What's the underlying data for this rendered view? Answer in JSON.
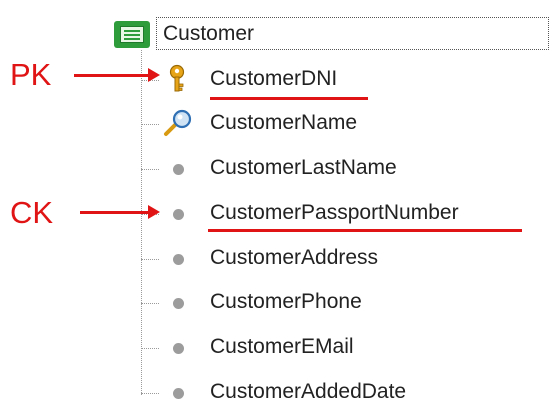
{
  "tree": {
    "root": {
      "label": "Customer",
      "icon": "transaction-table-icon"
    },
    "attributes": [
      {
        "label": "CustomerDNI",
        "icon": "key-icon"
      },
      {
        "label": "CustomerName",
        "icon": "search-key-icon"
      },
      {
        "label": "CustomerLastName",
        "icon": "attribute-dot-icon"
      },
      {
        "label": "CustomerPassportNumber",
        "icon": "attribute-dot-icon"
      },
      {
        "label": "CustomerAddress",
        "icon": "attribute-dot-icon"
      },
      {
        "label": "CustomerPhone",
        "icon": "attribute-dot-icon"
      },
      {
        "label": "CustomerEMail",
        "icon": "attribute-dot-icon"
      },
      {
        "label": "CustomerAddedDate",
        "icon": "attribute-dot-icon"
      }
    ]
  },
  "annotations": {
    "pk": "PK",
    "ck": "CK",
    "color": "#e01414"
  }
}
